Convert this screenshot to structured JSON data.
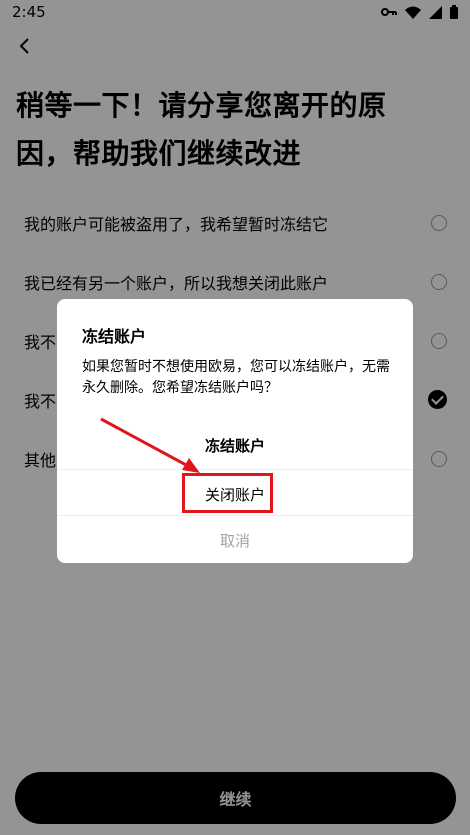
{
  "status_bar": {
    "time": "2:45",
    "icons": [
      "key-icon",
      "wifi-icon",
      "signal-icon",
      "battery-icon"
    ]
  },
  "page": {
    "title": "稍等一下！请分享您离开的原因，帮助我们继续改进",
    "options": [
      {
        "label": "我的账户可能被盗用了，我希望暂时冻结它",
        "selected": false
      },
      {
        "label": "我已经有另一个账户，所以我想关闭此账户",
        "selected": false
      },
      {
        "label": "我不",
        "selected": false
      },
      {
        "label": "我不",
        "selected": true
      },
      {
        "label": "其他",
        "selected": false
      }
    ],
    "continue_label": "继续"
  },
  "dialog": {
    "title": "冻结账户",
    "message": "如果您暂时不想使用欧易，您可以冻结账户，无需永久删除。您希望冻结账户吗？",
    "freeze_label": "冻结账户",
    "close_label": "关闭账户",
    "cancel_label": "取消"
  },
  "colors": {
    "highlight": "#e0161b",
    "overlay": "rgba(0,0,0,0.42)"
  }
}
